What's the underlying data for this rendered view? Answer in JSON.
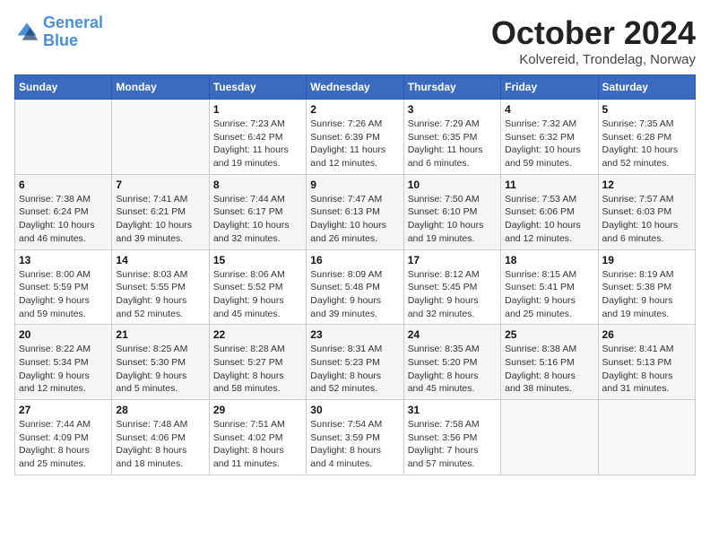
{
  "logo": {
    "line1": "General",
    "line2": "Blue"
  },
  "title": "October 2024",
  "subtitle": "Kolvereid, Trondelag, Norway",
  "days_of_week": [
    "Sunday",
    "Monday",
    "Tuesday",
    "Wednesday",
    "Thursday",
    "Friday",
    "Saturday"
  ],
  "weeks": [
    [
      {
        "day": "",
        "info": ""
      },
      {
        "day": "",
        "info": ""
      },
      {
        "day": "1",
        "info": "Sunrise: 7:23 AM\nSunset: 6:42 PM\nDaylight: 11 hours\nand 19 minutes."
      },
      {
        "day": "2",
        "info": "Sunrise: 7:26 AM\nSunset: 6:39 PM\nDaylight: 11 hours\nand 12 minutes."
      },
      {
        "day": "3",
        "info": "Sunrise: 7:29 AM\nSunset: 6:35 PM\nDaylight: 11 hours\nand 6 minutes."
      },
      {
        "day": "4",
        "info": "Sunrise: 7:32 AM\nSunset: 6:32 PM\nDaylight: 10 hours\nand 59 minutes."
      },
      {
        "day": "5",
        "info": "Sunrise: 7:35 AM\nSunset: 6:28 PM\nDaylight: 10 hours\nand 52 minutes."
      }
    ],
    [
      {
        "day": "6",
        "info": "Sunrise: 7:38 AM\nSunset: 6:24 PM\nDaylight: 10 hours\nand 46 minutes."
      },
      {
        "day": "7",
        "info": "Sunrise: 7:41 AM\nSunset: 6:21 PM\nDaylight: 10 hours\nand 39 minutes."
      },
      {
        "day": "8",
        "info": "Sunrise: 7:44 AM\nSunset: 6:17 PM\nDaylight: 10 hours\nand 32 minutes."
      },
      {
        "day": "9",
        "info": "Sunrise: 7:47 AM\nSunset: 6:13 PM\nDaylight: 10 hours\nand 26 minutes."
      },
      {
        "day": "10",
        "info": "Sunrise: 7:50 AM\nSunset: 6:10 PM\nDaylight: 10 hours\nand 19 minutes."
      },
      {
        "day": "11",
        "info": "Sunrise: 7:53 AM\nSunset: 6:06 PM\nDaylight: 10 hours\nand 12 minutes."
      },
      {
        "day": "12",
        "info": "Sunrise: 7:57 AM\nSunset: 6:03 PM\nDaylight: 10 hours\nand 6 minutes."
      }
    ],
    [
      {
        "day": "13",
        "info": "Sunrise: 8:00 AM\nSunset: 5:59 PM\nDaylight: 9 hours\nand 59 minutes."
      },
      {
        "day": "14",
        "info": "Sunrise: 8:03 AM\nSunset: 5:55 PM\nDaylight: 9 hours\nand 52 minutes."
      },
      {
        "day": "15",
        "info": "Sunrise: 8:06 AM\nSunset: 5:52 PM\nDaylight: 9 hours\nand 45 minutes."
      },
      {
        "day": "16",
        "info": "Sunrise: 8:09 AM\nSunset: 5:48 PM\nDaylight: 9 hours\nand 39 minutes."
      },
      {
        "day": "17",
        "info": "Sunrise: 8:12 AM\nSunset: 5:45 PM\nDaylight: 9 hours\nand 32 minutes."
      },
      {
        "day": "18",
        "info": "Sunrise: 8:15 AM\nSunset: 5:41 PM\nDaylight: 9 hours\nand 25 minutes."
      },
      {
        "day": "19",
        "info": "Sunrise: 8:19 AM\nSunset: 5:38 PM\nDaylight: 9 hours\nand 19 minutes."
      }
    ],
    [
      {
        "day": "20",
        "info": "Sunrise: 8:22 AM\nSunset: 5:34 PM\nDaylight: 9 hours\nand 12 minutes."
      },
      {
        "day": "21",
        "info": "Sunrise: 8:25 AM\nSunset: 5:30 PM\nDaylight: 9 hours\nand 5 minutes."
      },
      {
        "day": "22",
        "info": "Sunrise: 8:28 AM\nSunset: 5:27 PM\nDaylight: 8 hours\nand 58 minutes."
      },
      {
        "day": "23",
        "info": "Sunrise: 8:31 AM\nSunset: 5:23 PM\nDaylight: 8 hours\nand 52 minutes."
      },
      {
        "day": "24",
        "info": "Sunrise: 8:35 AM\nSunset: 5:20 PM\nDaylight: 8 hours\nand 45 minutes."
      },
      {
        "day": "25",
        "info": "Sunrise: 8:38 AM\nSunset: 5:16 PM\nDaylight: 8 hours\nand 38 minutes."
      },
      {
        "day": "26",
        "info": "Sunrise: 8:41 AM\nSunset: 5:13 PM\nDaylight: 8 hours\nand 31 minutes."
      }
    ],
    [
      {
        "day": "27",
        "info": "Sunrise: 7:44 AM\nSunset: 4:09 PM\nDaylight: 8 hours\nand 25 minutes."
      },
      {
        "day": "28",
        "info": "Sunrise: 7:48 AM\nSunset: 4:06 PM\nDaylight: 8 hours\nand 18 minutes."
      },
      {
        "day": "29",
        "info": "Sunrise: 7:51 AM\nSunset: 4:02 PM\nDaylight: 8 hours\nand 11 minutes."
      },
      {
        "day": "30",
        "info": "Sunrise: 7:54 AM\nSunset: 3:59 PM\nDaylight: 8 hours\nand 4 minutes."
      },
      {
        "day": "31",
        "info": "Sunrise: 7:58 AM\nSunset: 3:56 PM\nDaylight: 7 hours\nand 57 minutes."
      },
      {
        "day": "",
        "info": ""
      },
      {
        "day": "",
        "info": ""
      }
    ]
  ]
}
